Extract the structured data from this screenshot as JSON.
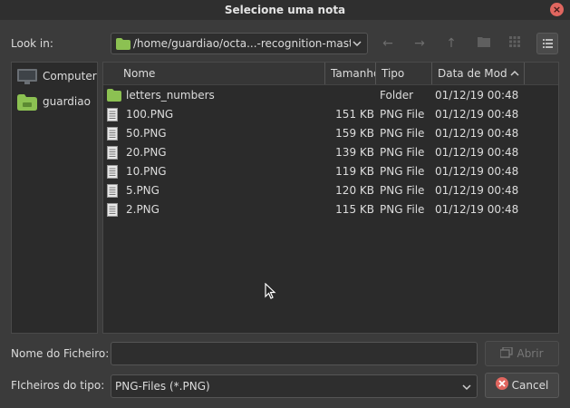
{
  "window": {
    "title": "Selecione uma nota",
    "close": "×"
  },
  "toolbar": {
    "look_in_label": "Look in:",
    "path": "/home/guardiao/octa...-recognition-master",
    "back_icon": "←",
    "forward_icon": "→",
    "up_icon": "↑"
  },
  "sidebar": {
    "items": [
      {
        "label": "Computer",
        "icon": "monitor-icon"
      },
      {
        "label": "guardiao",
        "icon": "folder-icon"
      }
    ]
  },
  "filelist": {
    "columns": [
      "Nome",
      "Tamanho",
      "Tipo",
      "Data de Modificação"
    ],
    "rows": [
      {
        "name": "letters_numbers",
        "size": "",
        "type": "Folder",
        "date": "01/12/19 00:48",
        "icon": "folder-icon"
      },
      {
        "name": "100.PNG",
        "size": "151 KB",
        "type": "PNG File",
        "date": "01/12/19 00:48",
        "icon": "file-icon"
      },
      {
        "name": "50.PNG",
        "size": "159 KB",
        "type": "PNG File",
        "date": "01/12/19 00:48",
        "icon": "file-icon"
      },
      {
        "name": "20.PNG",
        "size": "139 KB",
        "type": "PNG File",
        "date": "01/12/19 00:48",
        "icon": "file-icon"
      },
      {
        "name": "10.PNG",
        "size": "119 KB",
        "type": "PNG File",
        "date": "01/12/19 00:48",
        "icon": "file-icon"
      },
      {
        "name": "5.PNG",
        "size": "120 KB",
        "type": "PNG File",
        "date": "01/12/19 00:48",
        "icon": "file-icon"
      },
      {
        "name": "2.PNG",
        "size": "115 KB",
        "type": "PNG File",
        "date": "01/12/19 00:48",
        "icon": "file-icon"
      }
    ]
  },
  "footer": {
    "filename_label": "Nome do Ficheiro:",
    "filename_value": "",
    "filetype_label": "FIcheiros do tipo:",
    "filetype_value": "PNG-Files (*.PNG)",
    "open_label": "Abrir",
    "cancel_label": "Cancel"
  },
  "colors": {
    "folder": "#8cc152",
    "close": "#e0665f",
    "background": "#3b3b3b"
  }
}
